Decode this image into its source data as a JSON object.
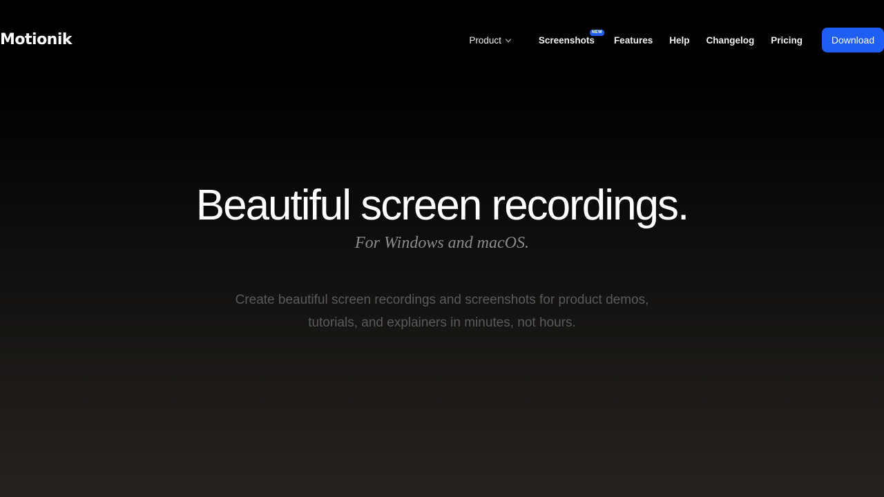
{
  "brand": {
    "logo_text": "Motionik"
  },
  "nav": {
    "product_label": "Product",
    "screenshots_label": "Screenshots",
    "screenshots_badge": "NEW",
    "features_label": "Features",
    "help_label": "Help",
    "changelog_label": "Changelog",
    "pricing_label": "Pricing",
    "download_label": "Download"
  },
  "hero": {
    "title": "Beautiful screen recordings.",
    "subtitle": "For Windows and macOS.",
    "description": "Create beautiful screen recordings and screenshots for product demos, tutorials, and explainers in minutes, not hours."
  },
  "icons": {
    "product_dropdown": "chevron-down-icon"
  },
  "colors": {
    "accent": "#1e5ef2",
    "background_top": "#000000",
    "background_bottom": "#252220",
    "subtitle": "#8e8c8a",
    "description": "#5b5a59"
  }
}
